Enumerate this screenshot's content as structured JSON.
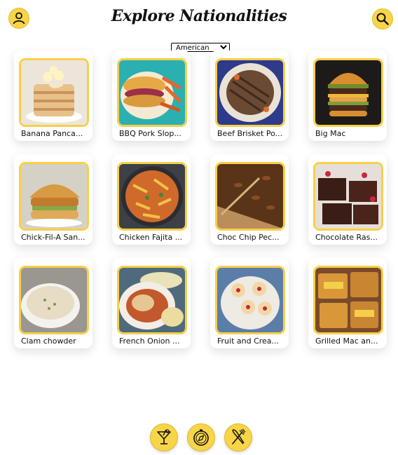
{
  "header": {
    "title": "Explore Nationalities",
    "profile_icon": "user-icon",
    "search_icon": "search-icon"
  },
  "nationality_select": {
    "selected": "American"
  },
  "recipes": [
    {
      "label": "Banana Panca..."
    },
    {
      "label": "BBQ Pork Slop..."
    },
    {
      "label": "Beef Brisket Po..."
    },
    {
      "label": "Big Mac"
    },
    {
      "label": "Chick-Fil-A San..."
    },
    {
      "label": "Chicken Fajita ..."
    },
    {
      "label": "Choc Chip Pec..."
    },
    {
      "label": "Chocolate Ras..."
    },
    {
      "label": "Clam chowder"
    },
    {
      "label": "French Onion ..."
    },
    {
      "label": "Fruit and Crea..."
    },
    {
      "label": "Grilled Mac an..."
    }
  ],
  "bottom_nav": {
    "items": [
      "cocktail-icon",
      "compass-icon",
      "fork-knife-icon"
    ]
  },
  "colors": {
    "accent": "#f8d548",
    "border": "#f7cf4a"
  }
}
